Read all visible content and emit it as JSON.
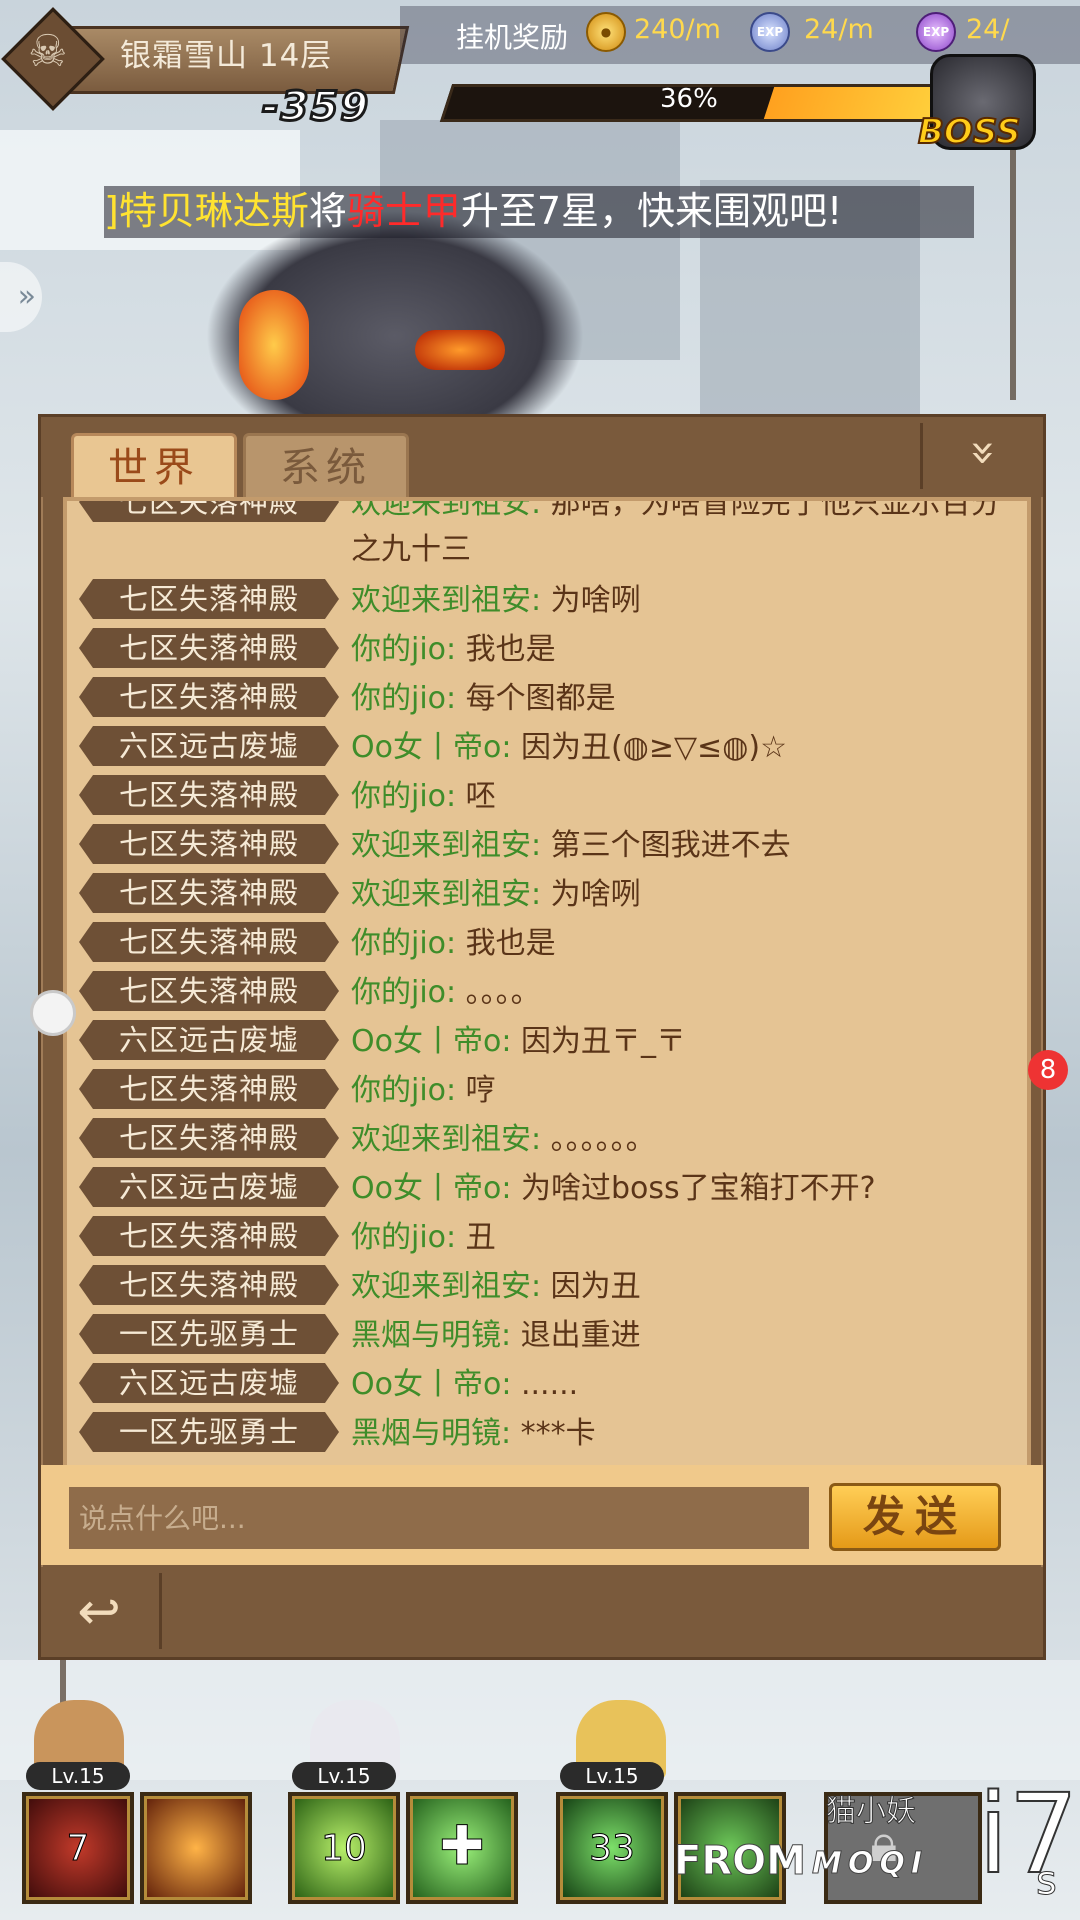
{
  "hud": {
    "stage_name": "银霜雪山 14层",
    "stage_score": "-359",
    "idle_label": "挂机奖励",
    "coin_rate": "240/m",
    "exp_rate": "24/m",
    "exp2_rate": "24/",
    "exp_icon_text": "EXP",
    "exp2_icon_text": "EXP",
    "boss_progress_text": "36%",
    "boss_progress": 0.36,
    "boss_label": "BOSS"
  },
  "announcement": {
    "name": "]特贝琳达斯",
    "verb1": "将",
    "item": "骑士甲",
    "verb2": "升至7星，快来围观吧!"
  },
  "chat": {
    "tabs": [
      "世界",
      "系统"
    ],
    "collapse_icon": "»",
    "messages": [
      {
        "server": "七区失落神殿",
        "sender": "欢迎来到祖安:",
        "text": " 那啥，为啥冒险完了他只显示百分之九十三"
      },
      {
        "server": "七区失落神殿",
        "sender": "欢迎来到祖安:",
        "text": " 为啥咧"
      },
      {
        "server": "七区失落神殿",
        "sender": "你的jio:",
        "text": " 我也是"
      },
      {
        "server": "七区失落神殿",
        "sender": "你的jio:",
        "text": " 每个图都是"
      },
      {
        "server": "六区远古废墟",
        "sender": "Oo女丨帝o:",
        "text": " 因为丑(◍≥▽≤◍)☆"
      },
      {
        "server": "七区失落神殿",
        "sender": "你的jio:",
        "text": " 呸"
      },
      {
        "server": "七区失落神殿",
        "sender": "欢迎来到祖安:",
        "text": " 第三个图我进不去"
      },
      {
        "server": "七区失落神殿",
        "sender": "欢迎来到祖安:",
        "text": " 为啥咧"
      },
      {
        "server": "七区失落神殿",
        "sender": "你的jio:",
        "text": " 我也是"
      },
      {
        "server": "七区失落神殿",
        "sender": "你的jio:",
        "text": " 。。。。"
      },
      {
        "server": "六区远古废墟",
        "sender": "Oo女丨帝o:",
        "text": " 因为丑〒_〒"
      },
      {
        "server": "七区失落神殿",
        "sender": "你的jio:",
        "text": " 哼"
      },
      {
        "server": "七区失落神殿",
        "sender": "欢迎来到祖安:",
        "text": " 。。。。。。"
      },
      {
        "server": "六区远古废墟",
        "sender": "Oo女丨帝o:",
        "text": " 为啥过boss了宝箱打不开?"
      },
      {
        "server": "七区失落神殿",
        "sender": "你的jio:",
        "text": " 丑"
      },
      {
        "server": "七区失落神殿",
        "sender": "欢迎来到祖安:",
        "text": " 因为丑"
      },
      {
        "server": "一区先驱勇士",
        "sender": "黑烟与明镜:",
        "text": " 退出重进"
      },
      {
        "server": "六区远古废墟",
        "sender": "Oo女丨帝o:",
        "text": " ......"
      },
      {
        "server": "一区先驱勇士",
        "sender": "黑烟与明镜:",
        "text": " ***卡"
      }
    ],
    "input_placeholder": "说点什么吧...",
    "send_label": "发送",
    "back_icon": "↩"
  },
  "side": {
    "badge": "8"
  },
  "heroes": [
    {
      "level": "Lv.15",
      "skill_count": "7"
    },
    {
      "level": "Lv.15",
      "skill_count": "10"
    },
    {
      "level": "Lv.15",
      "skill_count": "33"
    }
  ],
  "pet": {
    "name": "猫小妖"
  },
  "watermark": {
    "from": "FROM",
    "brand": "MOQI",
    "logo": "i7",
    "logo_sub": "s"
  },
  "colors": {
    "panel": "#7a5a3c",
    "chat_bg": "#e5c494",
    "server_tag": "#6e5036",
    "sender": "#3f8d2a",
    "announce_name": "#ffe330",
    "announce_item": "#ff2a2a"
  }
}
